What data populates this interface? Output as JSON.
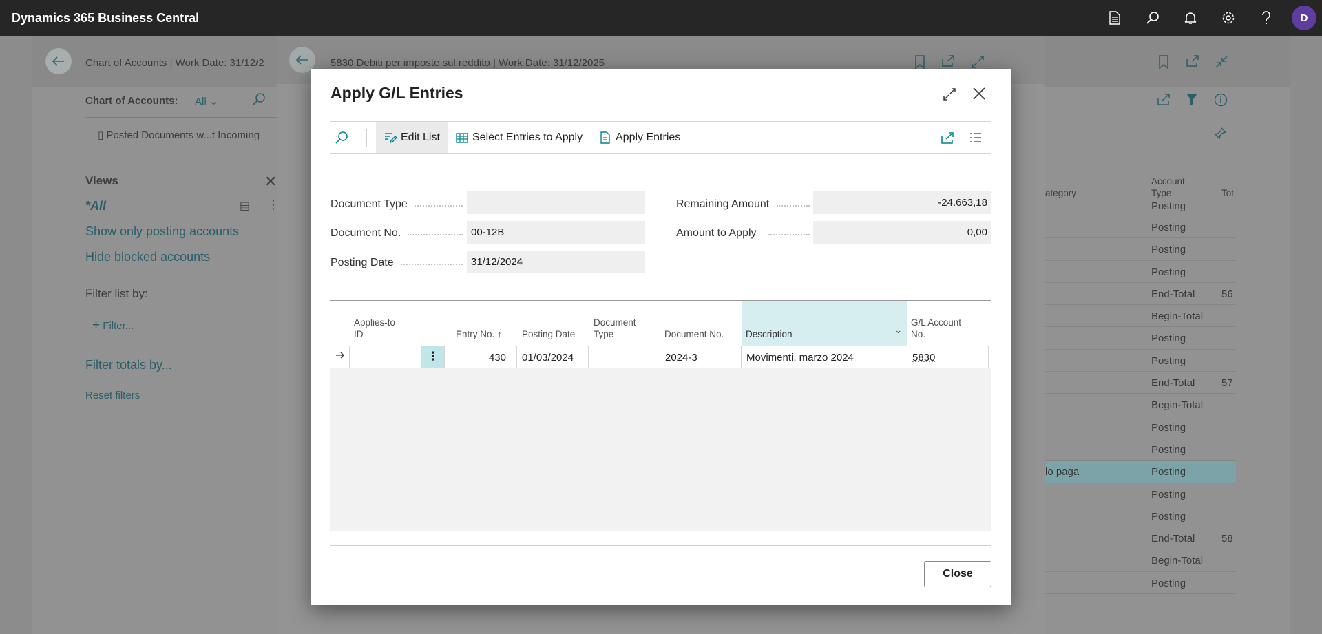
{
  "app": {
    "title": "Dynamics 365 Business Central",
    "user_initial": "D",
    "top_icons": [
      "document-icon",
      "search-icon",
      "bell-icon",
      "gear-icon",
      "help-icon"
    ]
  },
  "background_page": {
    "breadcrumb": "Chart of Accounts | Work Date: 31/12/2",
    "list_label": "Chart of Accounts:",
    "list_filter": "All",
    "action_label": "Posted Documents w...t Incoming",
    "views": {
      "title": "Views",
      "items": [
        "*All",
        "Show only posting accounts",
        "Hide blocked accounts"
      ],
      "filter_list_by": "Filter list by:",
      "filter_link": "Filter...",
      "filter_totals_by": "Filter totals by...",
      "reset_filters": "Reset filters"
    },
    "columns": {
      "category": "ategory",
      "account_type": "Account Type",
      "total": "Tot"
    },
    "rows": [
      {
        "cat": "",
        "type": "Posting",
        "total": ""
      },
      {
        "cat": "",
        "type": "Posting",
        "total": ""
      },
      {
        "cat": "",
        "type": "Posting",
        "total": ""
      },
      {
        "cat": "",
        "type": "End-Total",
        "total": "56"
      },
      {
        "cat": "",
        "type": "Begin-Total",
        "total": ""
      },
      {
        "cat": "",
        "type": "Posting",
        "total": ""
      },
      {
        "cat": "",
        "type": "Posting",
        "total": ""
      },
      {
        "cat": "",
        "type": "End-Total",
        "total": "57"
      },
      {
        "cat": "",
        "type": "Begin-Total",
        "total": ""
      },
      {
        "cat": "",
        "type": "Posting",
        "total": ""
      },
      {
        "cat": "",
        "type": "Posting",
        "total": ""
      },
      {
        "cat": "lo paga",
        "type": "Posting",
        "total": ""
      },
      {
        "cat": "",
        "type": "Posting",
        "total": ""
      },
      {
        "cat": "",
        "type": "Posting",
        "total": ""
      },
      {
        "cat": "",
        "type": "End-Total",
        "total": "58"
      },
      {
        "cat": "",
        "type": "Begin-Total",
        "total": ""
      },
      {
        "cat": "",
        "type": "Posting",
        "total": ""
      }
    ],
    "partial_top_row": "Posting"
  },
  "middle_page": {
    "breadcrumb": "5830 Debiti per imposte sul reddito | Work Date: 31/12/2025"
  },
  "dialog": {
    "title": "Apply G/L Entries",
    "toolbar": {
      "edit_list": "Edit List",
      "select_entries": "Select Entries to Apply",
      "apply_entries": "Apply Entries"
    },
    "fields": {
      "document_type_label": "Document Type",
      "document_type_value": "",
      "document_no_label": "Document No.",
      "document_no_value": "00-12B",
      "posting_date_label": "Posting Date",
      "posting_date_value": "31/12/2024",
      "remaining_amount_label": "Remaining Amount",
      "remaining_amount_value": "-24.663,18",
      "amount_to_apply_label": "Amount to Apply",
      "amount_to_apply_value": "0,00"
    },
    "grid": {
      "headers": {
        "applies_to_id": [
          "Applies-to",
          "ID"
        ],
        "entry_no": "Entry No.",
        "posting_date": "Posting Date",
        "document_type": [
          "Document",
          "Type"
        ],
        "document_no": "Document No.",
        "description": "Description",
        "gl_account_no": [
          "G/L Account",
          "No."
        ]
      },
      "rows": [
        {
          "applies_to_id": "",
          "entry_no": "430",
          "posting_date": "01/03/2024",
          "document_type": "",
          "document_no": "2024-3",
          "description": "Movimenti, marzo 2024",
          "gl_account_no": "5830"
        }
      ]
    },
    "close_label": "Close"
  },
  "colors": {
    "appbar": "#262626",
    "accent": "#008489",
    "avatar": "#5f3d9e",
    "selected_column": "#d7eef0"
  }
}
